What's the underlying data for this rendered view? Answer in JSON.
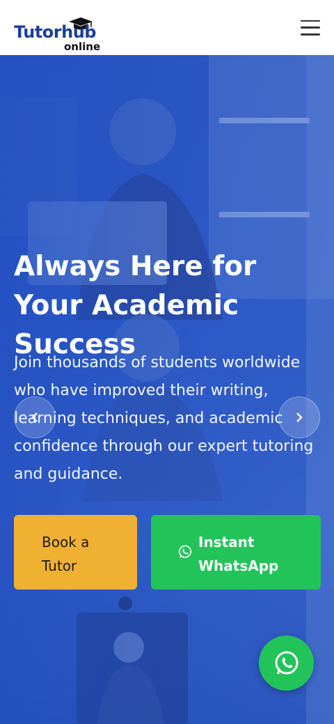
{
  "brand": {
    "name_main": "Tutorhub",
    "name_sub": "online"
  },
  "hero": {
    "headline": "Always Here for Your Academic Success",
    "description": "Join thousands of students worldwide who have improved their writing, learning techniques, and academic confidence through our expert tutoring and guidance."
  },
  "buttons": {
    "book": "Book a Tutor",
    "whatsapp": "Instant WhatsApp"
  },
  "colors": {
    "brand_blue": "#1b3f9a",
    "hero_blue": "#2d5ac8",
    "book_yellow": "#f0b133",
    "whatsapp_green": "#22c45a"
  },
  "icons": [
    "graduation-cap-icon",
    "hamburger-menu-icon",
    "chevron-left-icon",
    "chevron-right-icon",
    "whatsapp-icon"
  ]
}
